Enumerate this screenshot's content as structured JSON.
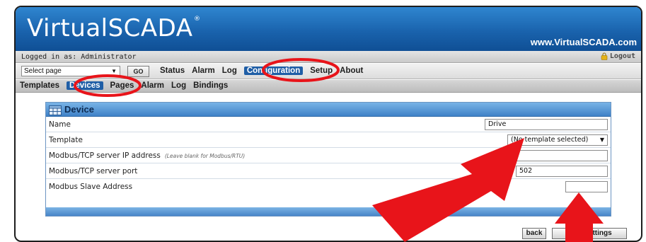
{
  "header": {
    "logo_text": "VirtualSCADA",
    "logo_reg": "®",
    "site_url": "www.VirtualSCADA.com"
  },
  "userbar": {
    "logged_in": "Logged in as: Administrator",
    "logout_label": "Logout",
    "logout_icon": "lock-icon"
  },
  "menubar": {
    "select_page_value": "Select page",
    "go_label": "GO",
    "items": [
      {
        "label": "Status",
        "active": false
      },
      {
        "label": "Alarm",
        "active": false
      },
      {
        "label": "Log",
        "active": false
      },
      {
        "label": "Configuration",
        "active": true
      },
      {
        "label": "Setup",
        "active": false
      },
      {
        "label": "About",
        "active": false
      }
    ]
  },
  "submenu": {
    "items": [
      {
        "label": "Templates",
        "active": false
      },
      {
        "label": "Devices",
        "active": true
      },
      {
        "label": "Pages",
        "active": false
      },
      {
        "label": "Alarm",
        "active": false
      },
      {
        "label": "Log",
        "active": false
      },
      {
        "label": "Bindings",
        "active": false
      }
    ]
  },
  "device_panel": {
    "title": "Device",
    "icon": "grid-icon",
    "fields": {
      "name": {
        "label": "Name",
        "value": "Drive"
      },
      "template": {
        "label": "Template",
        "value": "(No template selected)"
      },
      "ip": {
        "label": "Modbus/TCP server IP address",
        "hint": "(Leave blank for Modbus/RTU)",
        "value": ""
      },
      "port": {
        "label": "Modbus/TCP server port",
        "value": "502"
      },
      "slave": {
        "label": "Modbus Slave Address",
        "value": ""
      }
    }
  },
  "actions": {
    "back_label": "back",
    "save_label": "save settings"
  },
  "colors": {
    "banner_blue": "#1a63ad",
    "active_menu": "#1f5ea6",
    "annotation_red": "#e8141a"
  }
}
